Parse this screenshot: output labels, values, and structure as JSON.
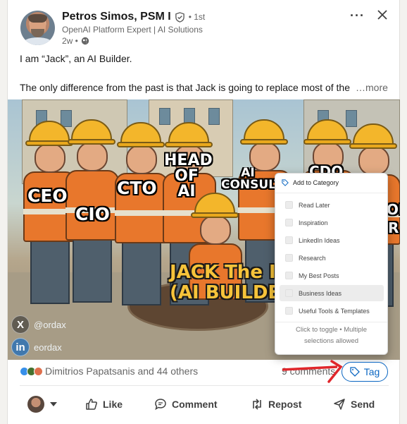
{
  "author": {
    "name": "Petros Simos, PSM I",
    "degree": "• 1st",
    "headline": "OpenAI Platform Expert | AI Solutions",
    "time": "2w •"
  },
  "post": {
    "line1": "I am “Jack”, an AI Builder.",
    "line2": "The only difference from the past is that Jack is going to replace most of the",
    "more": "…more"
  },
  "image": {
    "labels": [
      "CEO",
      "CIO",
      "CTO",
      "HEAD OF AI",
      "AI CONSULT",
      "CDO",
      "ON",
      "R"
    ],
    "jack_line1": "JACK The In",
    "jack_line2": "(AI BUILDE",
    "watermarks": [
      {
        "icon": "X",
        "handle": "@ordax"
      },
      {
        "icon": "in",
        "handle": "eordax"
      }
    ]
  },
  "popup": {
    "title": "Add to Category",
    "options": [
      "Read Later",
      "Inspiration",
      "LinkedIn Ideas",
      "Research",
      "My Best Posts",
      "Business Ideas",
      "Useful Tools & Templates"
    ],
    "highlighted": "Business Ideas",
    "footer_line1": "Click to toggle • Multiple",
    "footer_line2": "selections allowed"
  },
  "social": {
    "reactions": "Dimitrios Papatsanis and 44 others",
    "comments": "9 comments",
    "tag_label": "Tag"
  },
  "actions": {
    "like": "Like",
    "comment": "Comment",
    "repost": "Repost",
    "send": "Send"
  },
  "colors": {
    "link_blue": "#0a66c2",
    "arrow_red": "#e0262b",
    "helmet_yellow": "#f3b62b",
    "vest_orange": "#e8772c"
  }
}
